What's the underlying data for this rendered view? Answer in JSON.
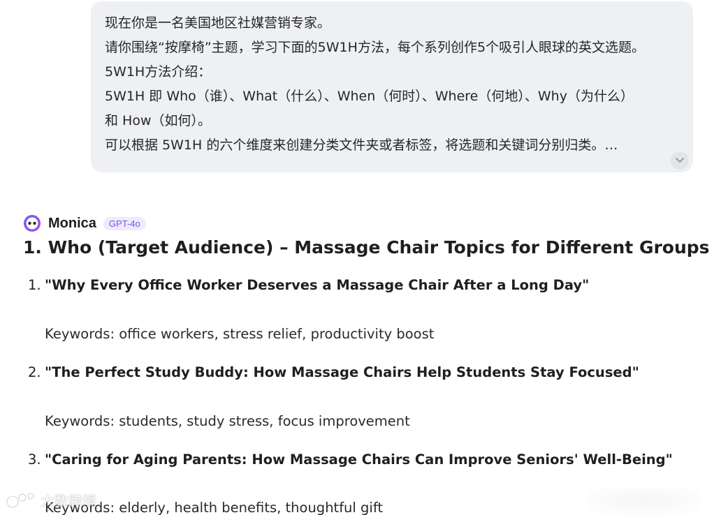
{
  "user_message": {
    "lines": [
      "现在你是一名美国地区社媒营销专家。",
      "请你围绕“按摩椅”主题，学习下面的5W1H方法，每个系列创作5个吸引人眼球的英文选题。",
      "5W1H方法介绍：",
      "5W1H 即 Who（谁）、What（什么）、When（何时）、Where（何地）、Why（为什么）",
      "和 How（如何）。",
      "可以根据 5W1H 的六个维度来创建分类文件夹或者标签，将选题和关键词分别归类。…"
    ]
  },
  "assistant": {
    "name": "Monica",
    "model": "GPT-4o",
    "section_title": "1. Who (Target Audience) – Massage Chair Topics for Different Groups",
    "topics": [
      {
        "number": "1.",
        "title": "\"Why Every Office Worker Deserves a Massage Chair After a Long Day\"",
        "keywords": "Keywords: office workers, stress relief, productivity boost"
      },
      {
        "number": "2.",
        "title": "\"The Perfect Study Buddy: How Massage Chairs Help Students Stay Focused\"",
        "keywords": "Keywords: students, study stress, focus improvement"
      },
      {
        "number": "3.",
        "title": "\"Caring for Aging Parents: How Massage Chairs Can Improve Seniors' Well-Being\"",
        "keywords": "Keywords: elderly, health benefits, thoughtful gift"
      }
    ]
  },
  "watermark": {
    "text": "大数跨境"
  },
  "colors": {
    "bubble_bg": "#eef0f3",
    "badge_text": "#7a56e0",
    "badge_bg": "#efe9fd"
  }
}
